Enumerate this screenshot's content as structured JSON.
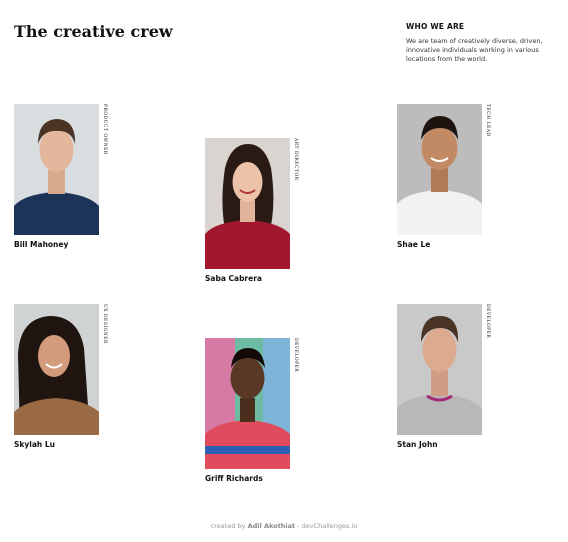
{
  "page": {
    "title": "The creative crew"
  },
  "about": {
    "heading": "WHO WE ARE",
    "text": "We are team of creatively diverse, driven, innovative individuals working in various locations from the world."
  },
  "members": [
    {
      "name": "Bill Mahoney",
      "role": "PRODUCT OWNER"
    },
    {
      "name": "Saba Cabrera",
      "role": "ART DIRECTOR"
    },
    {
      "name": "Shae Le",
      "role": "TECH LEAD"
    },
    {
      "name": "Skylah Lu",
      "role": "UX DESIGNER"
    },
    {
      "name": "Griff Richards",
      "role": "DEVELOPER"
    },
    {
      "name": "Stan John",
      "role": "DEVELOPER"
    }
  ],
  "footer": {
    "prefix": "created by",
    "author": "Adil Akothiat",
    "suffix": "- devChallenges.io"
  }
}
